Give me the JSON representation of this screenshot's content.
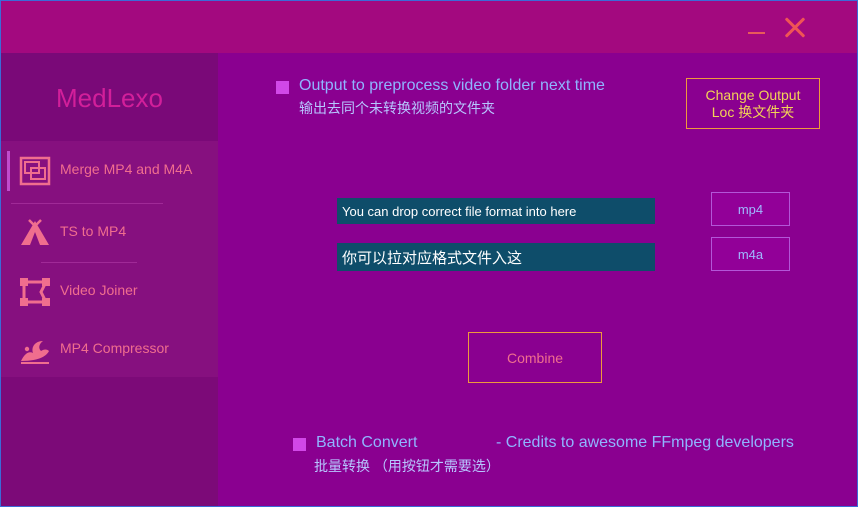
{
  "window": {
    "minimize_label": "",
    "close_label": ""
  },
  "sidebar": {
    "logo": "MedLexo",
    "items": [
      {
        "label": "Merge MP4 and M4A",
        "icon": "merge-frames-icon",
        "active": true
      },
      {
        "label": "TS to MP4",
        "icon": "tent-icon",
        "active": false
      },
      {
        "label": "Video Joiner",
        "icon": "vector-frame-icon",
        "active": false
      },
      {
        "label": "MP4 Compressor",
        "icon": "wave-icon",
        "active": false
      }
    ]
  },
  "main": {
    "output_option": {
      "label_en": "Output to preprocess video folder next time",
      "label_zh": "输出去同个未转换视频的文件夹"
    },
    "change_output": {
      "line1": "Change Output",
      "line2": "Loc 换文件夹"
    },
    "drop_mp4": {
      "text": "You can drop correct file format into here"
    },
    "drop_m4a": {
      "text": "你可以拉对应格式文件入这"
    },
    "mp4_button": "mp4",
    "m4a_button": "m4a",
    "combine_button": "Combine",
    "batch": {
      "label_en": "Batch Convert",
      "label_zh": "批量转换 （用按钮才需要选）"
    },
    "credits": "- Credits to awesome FFmpeg developers"
  },
  "colors": {
    "background": "#8a0090",
    "titlebar": "#a3097f",
    "sidebar": "#7c0a78",
    "accent_orange": "#ef9a3b",
    "text_blue": "#90b4ff",
    "nav_text": "#f06e8e",
    "drop_zone": "#0e4d6a"
  }
}
